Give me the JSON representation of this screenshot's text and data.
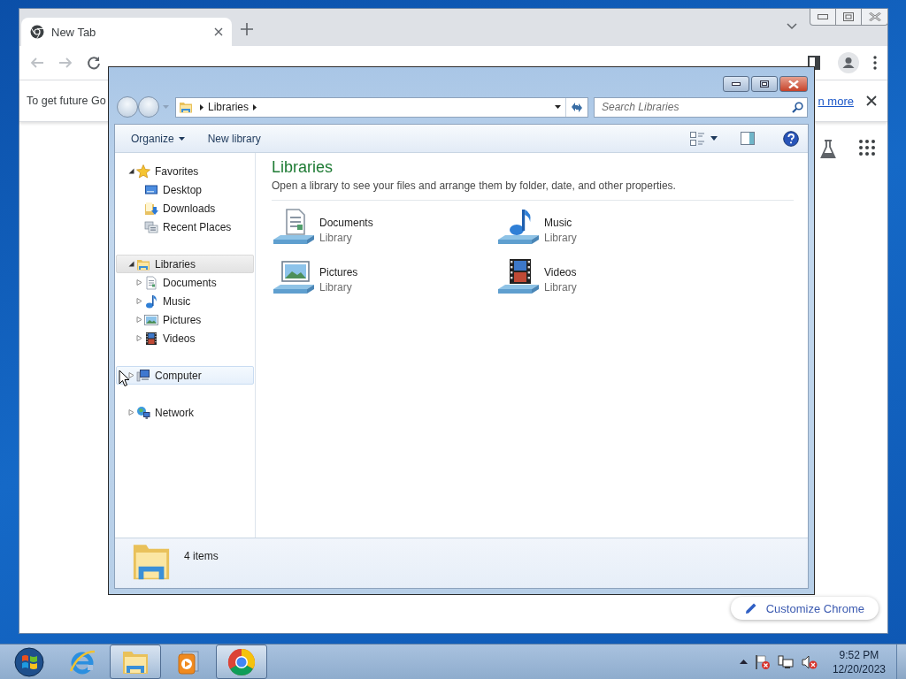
{
  "chrome": {
    "tabs": [
      {
        "title": "New Tab",
        "selected": true
      }
    ],
    "infobar": {
      "text": "To get future Go",
      "link": "n more"
    },
    "customize_button": "Customize Chrome"
  },
  "explorer": {
    "address": {
      "crumbs": [
        "Libraries"
      ]
    },
    "search": {
      "placeholder": "Search Libraries"
    },
    "toolbar": [
      {
        "label": "Organize",
        "menu": true
      },
      {
        "label": "New library",
        "menu": false
      }
    ],
    "nav": [
      {
        "label": "Favorites",
        "expanded": true,
        "selected": false,
        "hovered": false,
        "children": [
          {
            "label": "Desktop",
            "selected": false
          },
          {
            "label": "Downloads",
            "selected": false
          },
          {
            "label": "Recent Places",
            "selected": false
          }
        ]
      },
      {
        "label": "Libraries",
        "expanded": true,
        "selected": true,
        "hovered": false,
        "children": [
          {
            "label": "Documents",
            "expanded": false,
            "selected": false
          },
          {
            "label": "Music",
            "expanded": false,
            "selected": false
          },
          {
            "label": "Pictures",
            "expanded": false,
            "selected": false
          },
          {
            "label": "Videos",
            "expanded": false,
            "selected": false
          }
        ]
      },
      {
        "label": "Computer",
        "expanded": false,
        "selected": false,
        "hovered": true
      },
      {
        "label": "Network",
        "expanded": false,
        "selected": false,
        "hovered": false
      }
    ],
    "heading": "Libraries",
    "description": "Open a library to see your files and arrange them by folder, date, and other properties.",
    "libraries": [
      {
        "name": "Documents",
        "type": "Library"
      },
      {
        "name": "Music",
        "type": "Library"
      },
      {
        "name": "Pictures",
        "type": "Library"
      },
      {
        "name": "Videos",
        "type": "Library"
      }
    ],
    "status": "4 items"
  },
  "taskbar": {
    "items": [
      {
        "active": false
      },
      {
        "active": false
      },
      {
        "active": true
      },
      {
        "active": false
      },
      {
        "active": true
      }
    ],
    "time": "9:52 PM",
    "date": "12/20/2023"
  }
}
